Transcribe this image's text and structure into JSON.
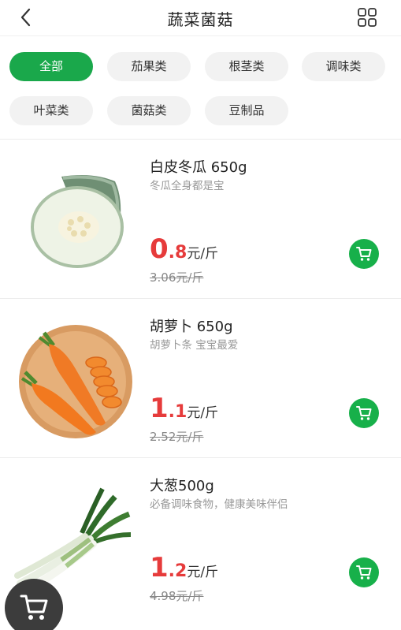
{
  "header": {
    "title": "蔬菜菌菇",
    "back_icon": "chevron-left-icon",
    "menu_icon": "grid-icon"
  },
  "tags": [
    {
      "label": "全部",
      "active": true
    },
    {
      "label": "茄果类",
      "active": false
    },
    {
      "label": "根茎类",
      "active": false
    },
    {
      "label": "调味类",
      "active": false
    },
    {
      "label": "叶菜类",
      "active": false
    },
    {
      "label": "菌菇类",
      "active": false
    },
    {
      "label": "豆制品",
      "active": false
    }
  ],
  "products": [
    {
      "name": "白皮冬瓜 650g",
      "desc": "冬瓜全身都是宝",
      "price_int": "0",
      "price_dec": ".8",
      "price_unit": "元/斤",
      "old_price": "3.06元/斤",
      "image_icon": "winter-melon-image"
    },
    {
      "name": "胡萝卜 650g",
      "desc": "胡萝卜条 宝宝最爱",
      "price_int": "1",
      "price_dec": ".1",
      "price_unit": "元/斤",
      "old_price": "2.52元/斤",
      "image_icon": "carrot-image"
    },
    {
      "name": "大葱500g",
      "desc": "必备调味食物，健康美味伴侣",
      "price_int": "1",
      "price_dec": ".2",
      "price_unit": "元/斤",
      "old_price": "4.98元/斤",
      "image_icon": "scallion-image"
    }
  ],
  "colors": {
    "accent": "#1aa84b",
    "price": "#e63b3b",
    "cart_float": "#3c3c3c"
  }
}
